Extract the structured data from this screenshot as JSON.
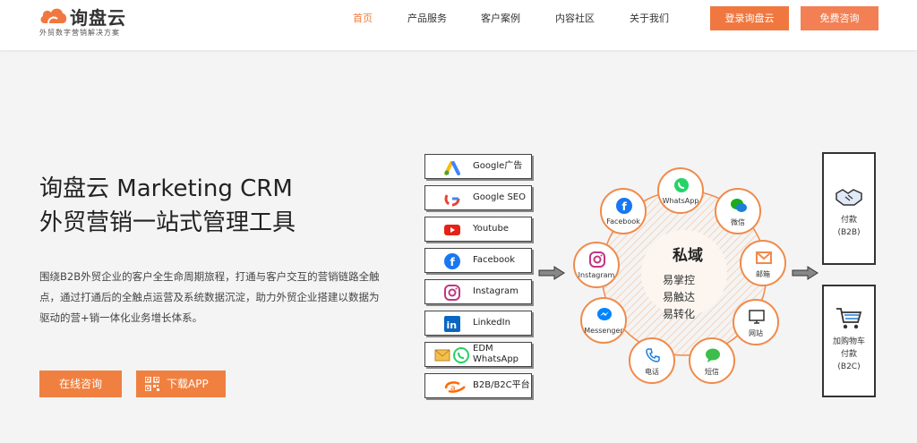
{
  "header": {
    "logo_name": "询盘云",
    "logo_slogan": "外贸数字营销解决方案",
    "nav": [
      "首页",
      "产品服务",
      "客户案例",
      "内容社区",
      "关于我们"
    ],
    "login_label": "登录询盘云",
    "consult_label": "免费咨询",
    "accent_color": "#f07840"
  },
  "hero": {
    "title_line1": "询盘云 Marketing CRM",
    "title_line2": "外贸营销一站式管理工具",
    "description": "围绕B2B外贸企业的客户全生命周期旅程，打通与客户交互的营销链路全触点，通过打通后的全触点运营及系统数据沉淀，助力外贸企业搭建以数据为驱动的营+销一体化业务增长体系。",
    "btn_online": "在线咨询",
    "btn_download": "下载APP"
  },
  "channels": [
    {
      "label": "Google广告",
      "icon": "google-ads-icon"
    },
    {
      "label": "Google SEO",
      "icon": "google-icon"
    },
    {
      "label": "Youtube",
      "icon": "youtube-icon"
    },
    {
      "label": "Facebook",
      "icon": "facebook-icon"
    },
    {
      "label": "Instagram",
      "icon": "instagram-icon"
    },
    {
      "label": "LinkedIn",
      "icon": "linkedin-icon"
    },
    {
      "label1": "EDM",
      "label2": "WhatsApp",
      "icon": "edm-whatsapp-icon"
    },
    {
      "label": "B2B/B2C平台",
      "icon": "alibaba-icon"
    }
  ],
  "private_domain": {
    "title": "私域",
    "lines": [
      "易掌控",
      "易触达",
      "易转化"
    ],
    "nodes": [
      "WhatsApp",
      "微信",
      "邮箱",
      "网站",
      "短信",
      "电话",
      "Messenger",
      "Instagram",
      "Facebook"
    ]
  },
  "outcomes": {
    "b2b_line1": "付款",
    "b2b_line2": "(B2B)",
    "b2c_line1": "加购物车",
    "b2c_line2": "付款",
    "b2c_line3": "(B2C)"
  }
}
